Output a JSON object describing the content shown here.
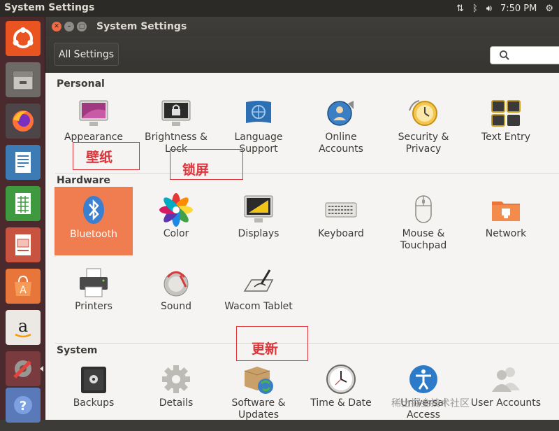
{
  "top_panel": {
    "title": "System Settings",
    "clock": "7:50 PM"
  },
  "window": {
    "title": "System Settings",
    "all_settings_label": "All Settings",
    "search_placeholder": ""
  },
  "sections": {
    "personal": {
      "title": "Personal",
      "items": [
        "Appearance",
        "Brightness & Lock",
        "Language Support",
        "Online Accounts",
        "Security & Privacy",
        "Text Entry"
      ]
    },
    "hardware": {
      "title": "Hardware",
      "items": [
        "Bluetooth",
        "Color",
        "Displays",
        "Keyboard",
        "Mouse & Touchpad",
        "Network",
        "Printers",
        "Sound",
        "Wacom Tablet"
      ]
    },
    "system": {
      "title": "System",
      "items": [
        "Backups",
        "Details",
        "Software & Updates",
        "Time & Date",
        "Universal Access",
        "User Accounts"
      ]
    }
  },
  "annotations": {
    "wallpaper": "壁纸",
    "lockscreen": "锁屏",
    "update": "更新"
  },
  "watermark": "稀土掘金技术社区",
  "colors": {
    "accent": "#f07d50",
    "annotation": "#e0333a",
    "launcher_bg": "#4a2a2d"
  },
  "icons": {
    "launcher": [
      "ubuntu-dash-icon",
      "files-icon",
      "firefox-icon",
      "writer-icon",
      "calc-icon",
      "impress-icon",
      "software-center-icon",
      "amazon-icon",
      "system-settings-icon",
      "help-icon"
    ]
  }
}
